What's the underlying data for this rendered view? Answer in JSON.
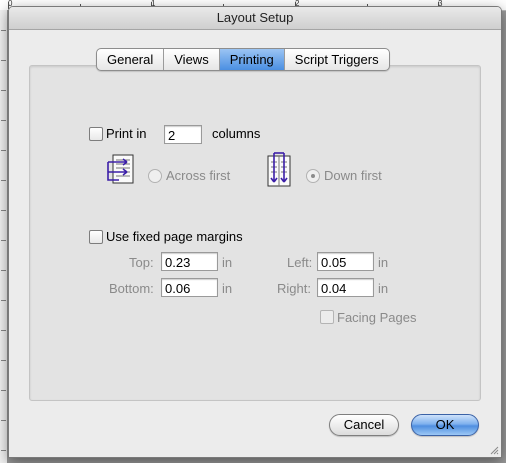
{
  "ruler": {
    "labels": [
      "0",
      "1",
      "2",
      "3"
    ]
  },
  "window": {
    "title": "Layout Setup"
  },
  "tabs": [
    {
      "label": "General",
      "active": false
    },
    {
      "label": "Views",
      "active": false
    },
    {
      "label": "Printing",
      "active": true
    },
    {
      "label": "Script Triggers",
      "active": false
    }
  ],
  "print_columns": {
    "checkbox_label": "Print in",
    "checked": false,
    "columns_value": "2",
    "suffix": "columns",
    "across_label": "Across first",
    "down_label": "Down first",
    "selected": "Down first"
  },
  "margins": {
    "checkbox_label": "Use fixed page margins",
    "checked": false,
    "top_label": "Top:",
    "top_value": "0.23",
    "bottom_label": "Bottom:",
    "bottom_value": "0.06",
    "left_label": "Left:",
    "left_value": "0.05",
    "right_label": "Right:",
    "right_value": "0.04",
    "unit": "in",
    "facing_pages_label": "Facing Pages"
  },
  "buttons": {
    "cancel": "Cancel",
    "ok": "OK"
  },
  "colors": {
    "accent": "#4b8fe2",
    "window_bg": "#ececec",
    "panel_bg": "#e3e3e3",
    "disabled_text": "#8a8a8a"
  }
}
